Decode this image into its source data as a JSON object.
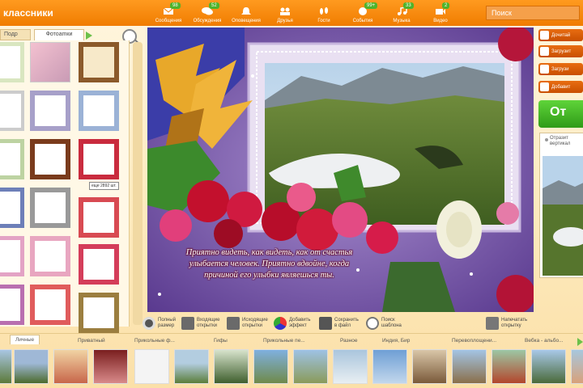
{
  "app": {
    "logo": "классники"
  },
  "nav": [
    {
      "label": "Сообщения",
      "badge": "98",
      "icon": "envelope-icon"
    },
    {
      "label": "Обсуждения",
      "badge": "52",
      "icon": "chat-icon"
    },
    {
      "label": "Оповещения",
      "badge": "",
      "icon": "bell-icon"
    },
    {
      "label": "Друзья",
      "badge": "",
      "icon": "friends-icon"
    },
    {
      "label": "Гости",
      "badge": "",
      "icon": "footprints-icon"
    },
    {
      "label": "События",
      "badge": "99+",
      "icon": "events-icon"
    },
    {
      "label": "Музыка",
      "badge": "33",
      "icon": "music-icon"
    },
    {
      "label": "Видео",
      "badge": "2",
      "icon": "video-icon"
    }
  ],
  "search": {
    "placeholder": "Поиск"
  },
  "left": {
    "tab_podr": "Подр",
    "tab_photos": "Фотоаmки",
    "tooltip": "еще 2892 шт."
  },
  "poem": {
    "lines": [
      "Приятно видеть, как видеть, как от счастья",
      "улыбается человек. Приятно вдвойне, когда",
      "причиной его улыбки являешься ты."
    ]
  },
  "actions": [
    {
      "label1": "Полный",
      "label2": "размер"
    },
    {
      "label1": "Входящие",
      "label2": "открытки"
    },
    {
      "label1": "Исходящие",
      "label2": "открытки"
    },
    {
      "label1": "Добавить",
      "label2": "эффект"
    },
    {
      "label1": "Сохранить",
      "label2": "в файл"
    },
    {
      "label1": "Поиск",
      "label2": "шаблона"
    },
    {
      "label1": "Напечатать",
      "label2": "открытку"
    }
  ],
  "right": {
    "buttons": [
      "Дочитай",
      "Загрузит",
      "Загрузи",
      "Добавит"
    ],
    "send": "От",
    "preview_text1": "Отразит",
    "preview_text2": "вертикал"
  },
  "albums": [
    "Личные",
    "Приватный",
    "Прикольные ф...",
    "Гифы",
    "Прикольные пе...",
    "Разное",
    "Индия, Бир",
    "Перевоплощени...",
    "Вебка - альбо..."
  ],
  "colors": {
    "topbar": "#f07c00",
    "accent_green": "#4fb32b",
    "panel_bg": "#fff8e6"
  }
}
